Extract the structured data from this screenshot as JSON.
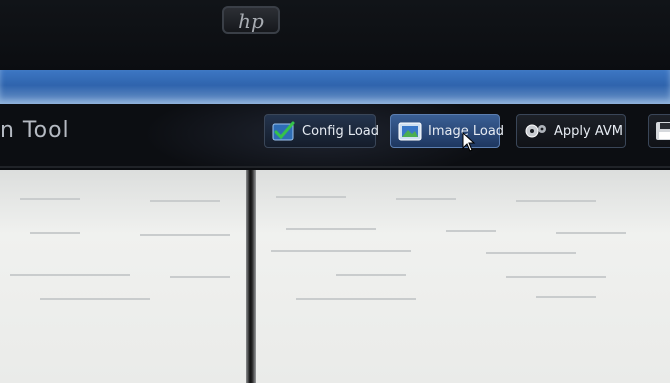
{
  "monitor": {
    "logo_text": "hp"
  },
  "app": {
    "title": "n Tool"
  },
  "toolbar": {
    "config_load": "Config Load",
    "image_load": "Image Load",
    "apply_avm": "Apply AVM"
  },
  "colors": {
    "titlebar": "#3d77c4",
    "toolbar_bg": "#0c0e12",
    "pane_bg": "#eceeeb",
    "active_button": "#3a5f95"
  },
  "icons": {
    "config_load": "checkmark-icon",
    "image_load": "image-icon",
    "apply_avm": "gear-icon",
    "save": "save-icon",
    "cursor": "mouse-cursor"
  }
}
